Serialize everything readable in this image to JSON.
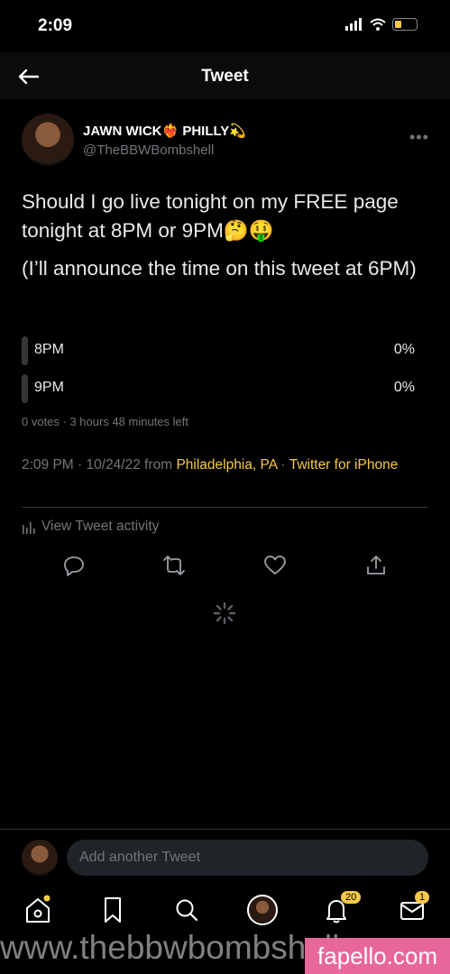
{
  "status_bar": {
    "time": "2:09"
  },
  "header": {
    "title": "Tweet"
  },
  "author": {
    "display_name": "JAWN WICK❤️‍🔥 PHILLY💫",
    "handle": "@TheBBWBombshell"
  },
  "tweet": {
    "line1": "Should I go live tonight on my FREE page tonight at 8PM or 9PM🤔🤑",
    "line2": "(I’ll announce the time on this tweet at 6PM)"
  },
  "poll": {
    "options": [
      {
        "label": "8PM",
        "percent": "0%"
      },
      {
        "label": "9PM",
        "percent": "0%"
      }
    ],
    "meta": "0 votes · 3 hours 48 minutes left"
  },
  "meta": {
    "time_date": "2:09 PM · 10/24/22 from ",
    "location": "Philadelphia, PA",
    "sep": " · ",
    "client": "Twitter for iPhone"
  },
  "activity": {
    "label": "View Tweet activity"
  },
  "compose": {
    "placeholder": "Add another Tweet"
  },
  "nav": {
    "notifications_badge": "20",
    "messages_badge": "1"
  },
  "watermarks": {
    "left": "www.thebbwbombshell.c",
    "right": "fapello.com"
  },
  "colors": {
    "background": "#000000",
    "accent": "#f7c948",
    "muted": "#71767b"
  }
}
